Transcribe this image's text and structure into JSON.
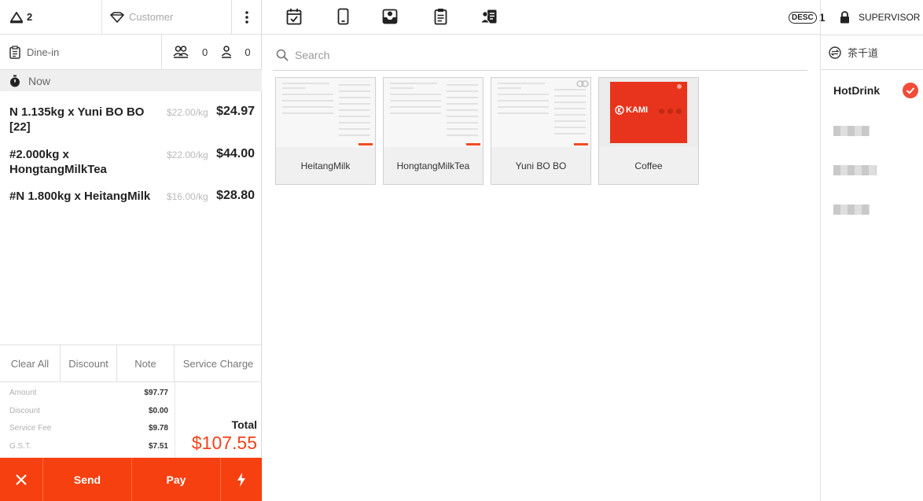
{
  "order_header": {
    "table_number": "2",
    "customer_placeholder": "Customer",
    "order_type": "Dine-in",
    "guests_count": "0",
    "person_count": "0",
    "time_label": "Now"
  },
  "order_items": [
    {
      "name": "N 1.135kg x  Yuni BO BO [22]",
      "unit_price": "$22.00/kg",
      "total": "$24.97"
    },
    {
      "name": "#2.000kg x HongtangMilkTea",
      "unit_price": "$22.00/kg",
      "total": "$44.00"
    },
    {
      "name": "#N 1.800kg x  HeitangMilk",
      "unit_price": "$16.00/kg",
      "total": "$28.80"
    }
  ],
  "actions": {
    "clear_all": "Clear All",
    "discount": "Discount",
    "note": "Note",
    "service_charge": "Service Charge"
  },
  "summary": {
    "amount_label": "Amount",
    "amount": "$97.77",
    "discount_label": "Discount",
    "discount": "$0.00",
    "service_fee_label": "Service Fee",
    "service_fee": "$9.78",
    "gst_label": "G.S.T.",
    "gst": "$7.51",
    "total_label": "Total",
    "total": "$107.55"
  },
  "bottom_bar": {
    "send": "Send",
    "pay": "Pay"
  },
  "header_right": {
    "desc_badge": "DESC",
    "desc_count": "1",
    "user_role": "SUPERVISOR"
  },
  "search": {
    "placeholder": "Search"
  },
  "products": [
    {
      "name": "HeitangMilk"
    },
    {
      "name": "HongtangMilkTea"
    },
    {
      "name": "Yuni  BO  BO"
    },
    {
      "name": "Coffee",
      "logo_text": "KAMI"
    }
  ],
  "categories": {
    "store_name": "茶千道",
    "selected": "HotDrink"
  },
  "colors": {
    "accent": "#f6400f",
    "total_red": "#f2421b",
    "check_red": "#f24b3a"
  }
}
